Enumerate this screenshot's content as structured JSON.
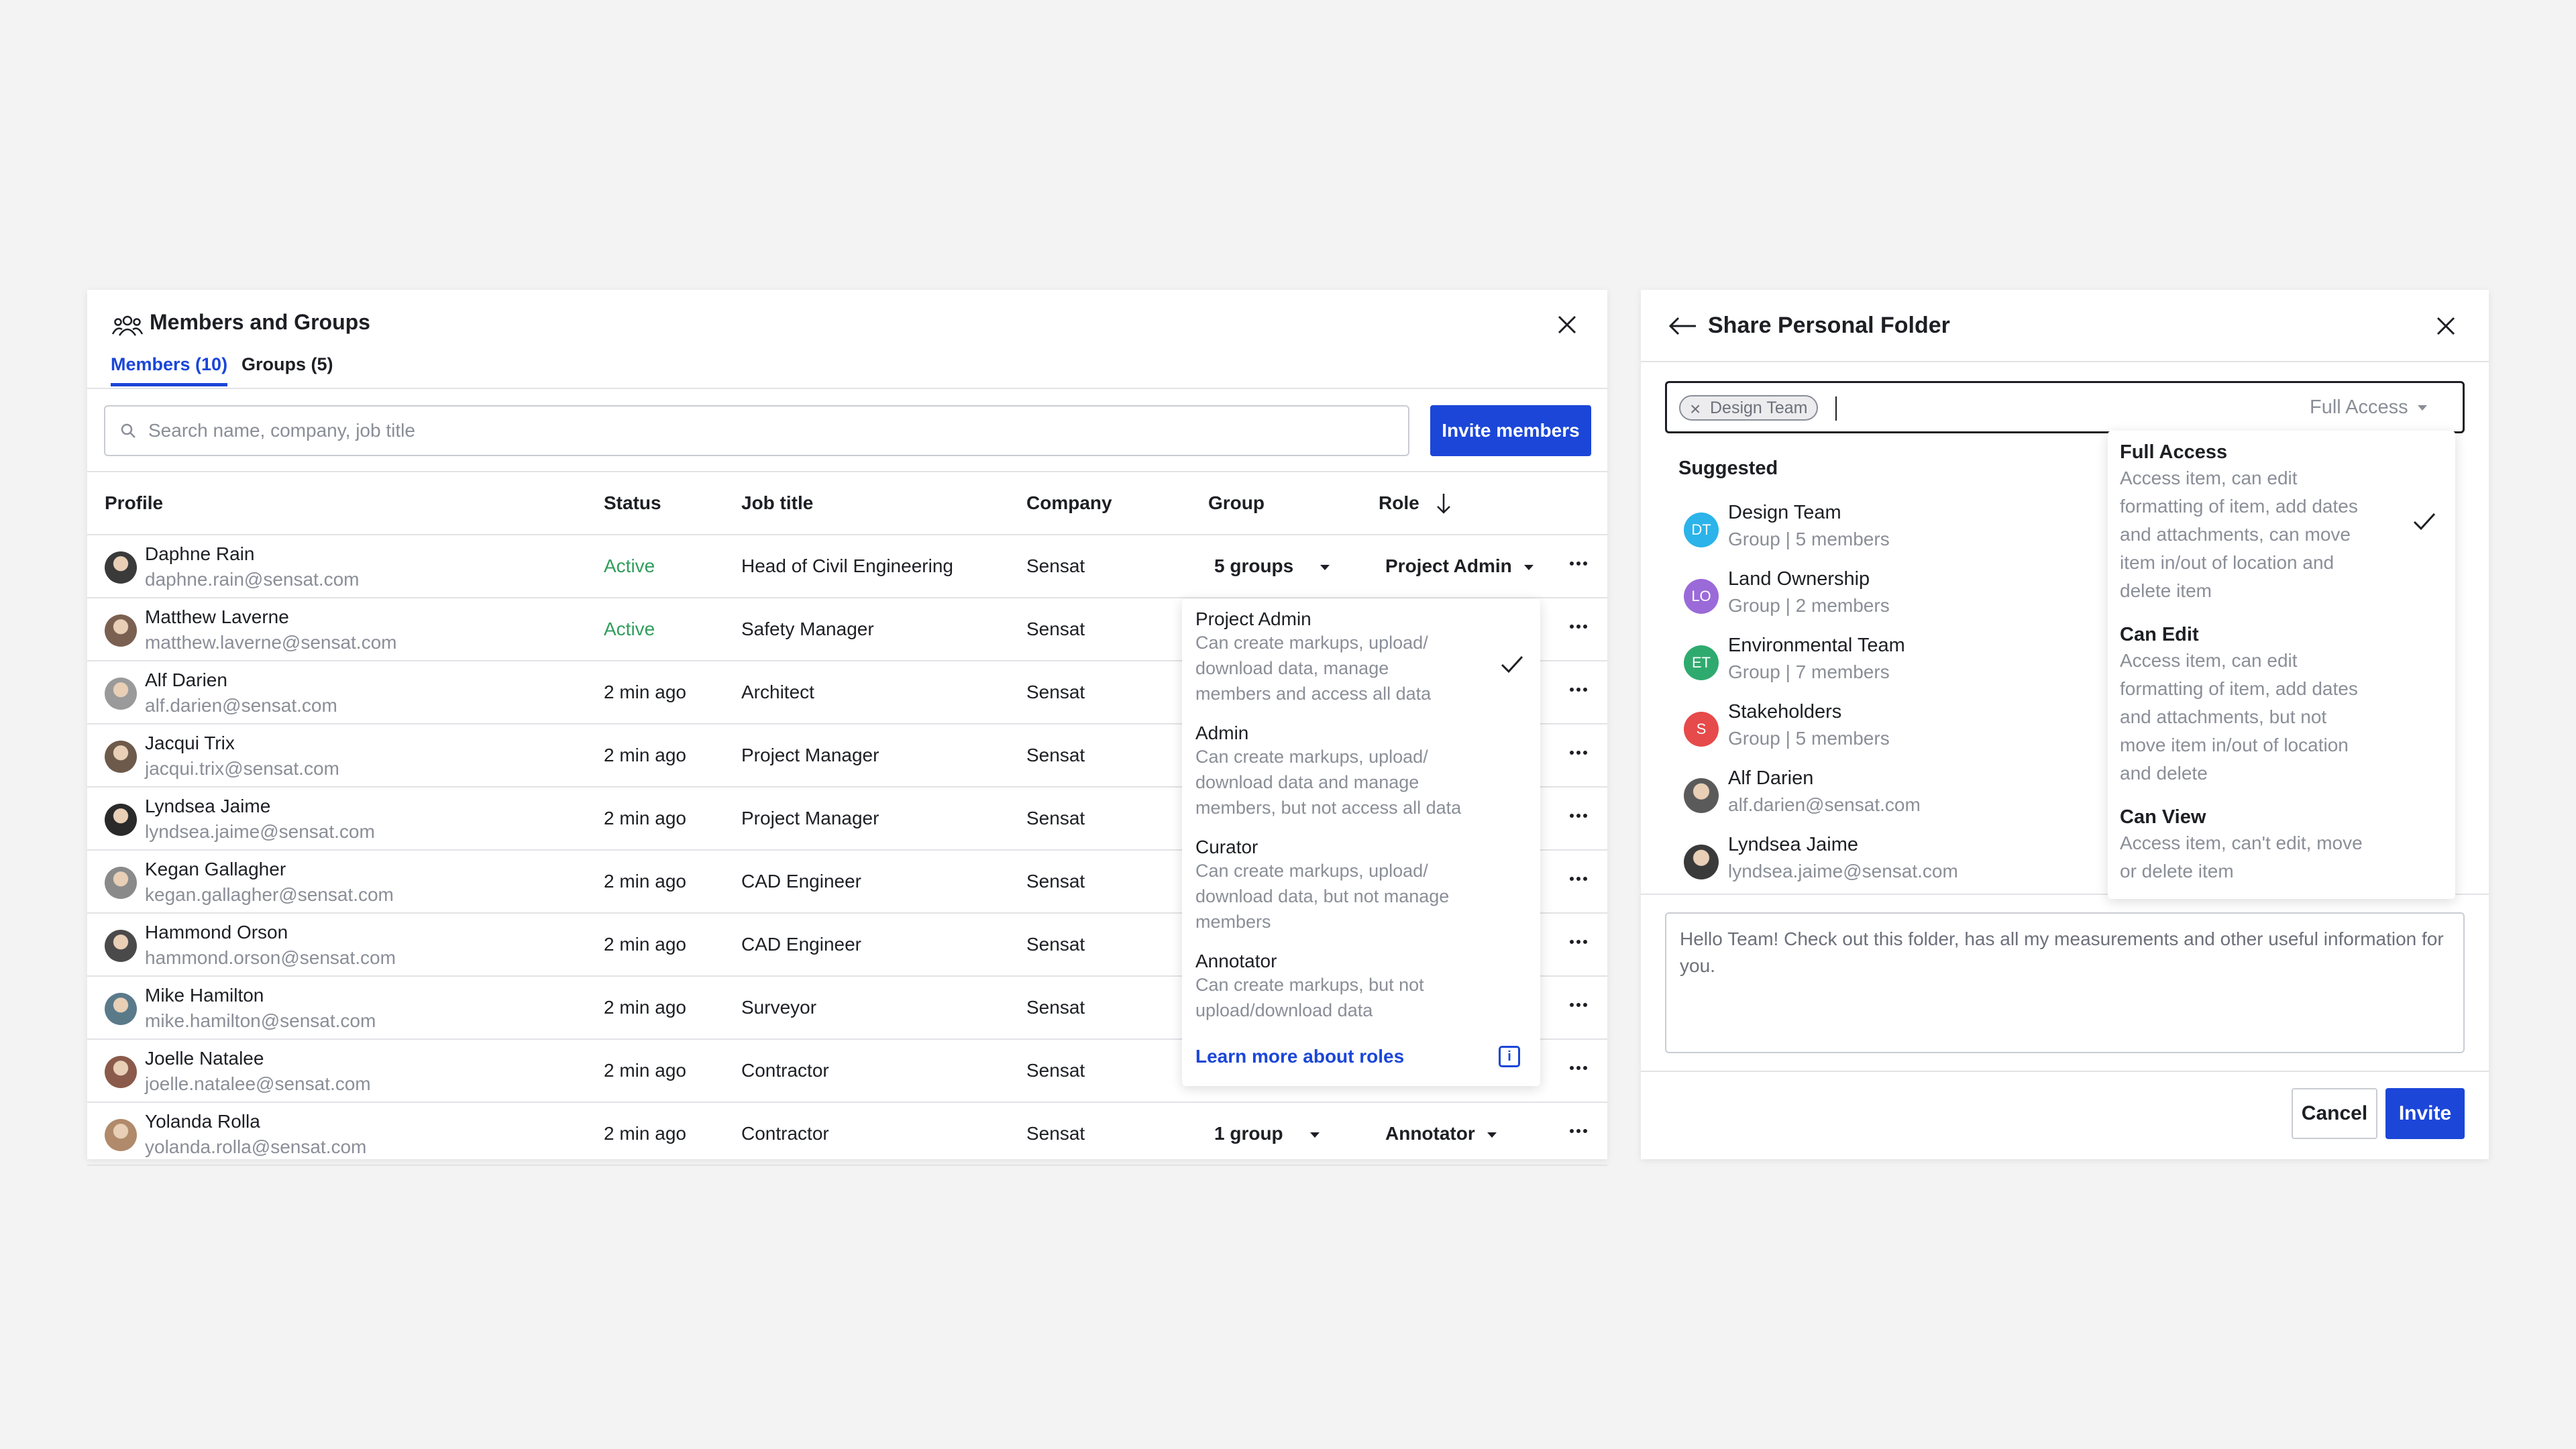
{
  "members_panel": {
    "title": "Members and Groups",
    "tabs": [
      {
        "label": "Members (10)"
      },
      {
        "label": "Groups (5)"
      }
    ],
    "search_placeholder": "Search name, company, job title",
    "invite_label": "Invite members",
    "columns": [
      "Profile",
      "Status",
      "Job title",
      "Company",
      "Group",
      "Role"
    ],
    "rows": [
      {
        "name": "Daphne Rain",
        "email": "daphne.rain@sensat.com",
        "status": "Active",
        "job": "Head of Civil Engineering",
        "company": "Sensat",
        "group": "5 groups",
        "role": "Project Admin"
      },
      {
        "name": "Matthew Laverne",
        "email": "matthew.laverne@sensat.com",
        "status": "Active",
        "job": "Safety Manager",
        "company": "Sensat"
      },
      {
        "name": "Alf Darien",
        "email": "alf.darien@sensat.com",
        "status": "2 min ago",
        "job": "Architect",
        "company": "Sensat"
      },
      {
        "name": "Jacqui Trix",
        "email": "jacqui.trix@sensat.com",
        "status": "2 min ago",
        "job": "Project Manager",
        "company": "Sensat"
      },
      {
        "name": "Lyndsea Jaime",
        "email": "lyndsea.jaime@sensat.com",
        "status": "2 min ago",
        "job": "Project Manager",
        "company": "Sensat"
      },
      {
        "name": "Kegan Gallagher",
        "email": "kegan.gallagher@sensat.com",
        "status": "2 min ago",
        "job": "CAD Engineer",
        "company": "Sensat"
      },
      {
        "name": "Hammond Orson",
        "email": "hammond.orson@sensat.com",
        "status": "2 min ago",
        "job": "CAD Engineer",
        "company": "Sensat"
      },
      {
        "name": "Mike Hamilton",
        "email": "mike.hamilton@sensat.com",
        "status": "2 min ago",
        "job": "Surveyor",
        "company": "Sensat"
      },
      {
        "name": "Joelle Natalee",
        "email": "joelle.natalee@sensat.com",
        "status": "2 min ago",
        "job": "Contractor",
        "company": "Sensat"
      },
      {
        "name": "Yolanda Rolla",
        "email": "yolanda.rolla@sensat.com",
        "status": "2 min ago",
        "job": "Contractor",
        "company": "Sensat",
        "group": "1 group",
        "role": "Annotator"
      }
    ]
  },
  "role_popover": {
    "options": [
      {
        "title": "Project Admin",
        "desc_lines": [
          "Can create markups, upload/",
          "download data, manage",
          "members and access all data"
        ],
        "selected": true
      },
      {
        "title": "Admin",
        "desc_lines": [
          "Can create markups, upload/",
          "download data and manage",
          "members, but not access all data"
        ]
      },
      {
        "title": "Curator",
        "desc_lines": [
          "Can create markups, upload/",
          "download data, but not manage",
          "members"
        ]
      },
      {
        "title": "Annotator",
        "desc_lines": [
          "Can create markups, but not",
          "upload/download data"
        ]
      }
    ],
    "learn_more": "Learn more about roles",
    "info_glyph": "i"
  },
  "share_panel": {
    "title": "Share Personal Folder",
    "chip_label": "Design Team",
    "access_value": "Full Access",
    "suggested_title": "Suggested",
    "suggested": [
      {
        "initials": "DT",
        "name": "Design Team",
        "sub": "Group | 5 members",
        "color": "#2bb3ea"
      },
      {
        "initials": "LO",
        "name": "Land Ownership",
        "sub": "Group | 2 members",
        "color": "#9b6ad9"
      },
      {
        "initials": "ET",
        "name": "Environmental Team",
        "sub": "Group | 7 members",
        "color": "#2faa6f"
      },
      {
        "initials": "S",
        "name": "Stakeholders",
        "sub": "Group | 5 members",
        "color": "#e64a4a"
      },
      {
        "initials": "",
        "name": "Alf Darien",
        "sub": "alf.darien@sensat.com",
        "color": "#5a5a5a"
      },
      {
        "initials": "",
        "name": "Lyndsea Jaime",
        "sub": "lyndsea.jaime@sensat.com",
        "color": "#3a3a3a"
      }
    ],
    "message": "Hello Team! Check out this folder, has all my measurements and other useful information for you.",
    "cancel_label": "Cancel",
    "invite_label": "Invite"
  },
  "access_popover": {
    "options": [
      {
        "title": "Full Access",
        "desc_lines": [
          "Access item, can edit",
          "formatting of item, add dates",
          "and attachments, can move",
          "item in/out of location and",
          "delete item"
        ],
        "selected": true
      },
      {
        "title": "Can Edit",
        "desc_lines": [
          "Access item, can edit",
          "formatting of item, add dates",
          "and attachments, but not",
          "move item in/out of location",
          "and delete"
        ]
      },
      {
        "title": "Can View",
        "desc_lines": [
          "Access item, can't edit, move",
          "or delete item"
        ]
      }
    ]
  },
  "colors": {
    "accent": "#1b46d8",
    "active_status": "#2f9e5b",
    "muted_text": "#8a8e97"
  }
}
